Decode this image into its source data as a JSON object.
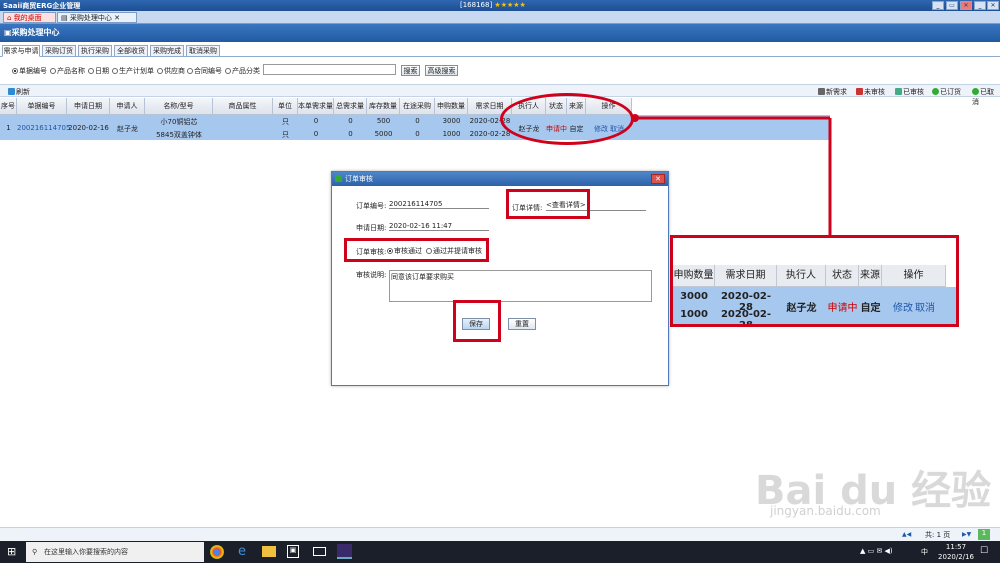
{
  "app": {
    "title": "Saaii商贸ERG企业管理",
    "license": "[168168]",
    "stars": "★★★★★"
  },
  "window_controls": [
    "_",
    "▭",
    "✕",
    "_",
    "▭",
    "✕"
  ],
  "top_tabs": [
    {
      "label": "我的桌面"
    },
    {
      "label": "采购处理中心"
    }
  ],
  "page_title": "采购处理中心",
  "sub_tabs": [
    "需求与申请",
    "采购订货",
    "执行采购",
    "全部收货",
    "采购完成",
    "取消采购"
  ],
  "search": {
    "options": [
      "单据编号",
      "产品名称",
      "日期",
      "生产计划单",
      "供应商",
      "合同编号",
      "产品分类"
    ],
    "selected": 0,
    "value": "",
    "search_label": "搜索",
    "advanced_label": "高级搜索"
  },
  "toolbar": {
    "refresh": "刷新",
    "actions": [
      "新需求",
      "未审核",
      "已审核",
      "已订货",
      "已取消"
    ]
  },
  "table": {
    "headers": [
      "序号",
      "单据编号",
      "申请日期",
      "申请人",
      "名称/型号",
      "商品属性",
      "单位",
      "本单需求量",
      "总需求量",
      "库存数量",
      "在途采购量",
      "申购数量",
      "需求日期",
      "执行人",
      "状态",
      "来源",
      "操作"
    ],
    "row": {
      "index": "1",
      "doc_no": "200216114705",
      "date": "2020-02-16",
      "applicant": "赵子龙",
      "items": [
        {
          "name": "小70铜铝芯",
          "unit": "只",
          "need": "0",
          "total": "0",
          "stock": "500",
          "transit": "0",
          "qty": "3000",
          "due": "2020-02-28"
        },
        {
          "name": "5845双盖钟体",
          "unit": "只",
          "need": "0",
          "total": "0",
          "stock": "5000",
          "transit": "0",
          "qty": "1000",
          "due": "2020-02-28"
        }
      ],
      "executor": "赵子龙",
      "status": "申请中",
      "source": "自定",
      "ops": [
        "修改",
        "取消"
      ]
    }
  },
  "zoom": {
    "headers": [
      "申购数量",
      "需求日期",
      "执行人",
      "状态",
      "来源",
      "操作"
    ],
    "qty": [
      "3000",
      "1000"
    ],
    "due": [
      "2020-02-28",
      "2020-02-28"
    ],
    "executor": "赵子龙",
    "status": "申请中",
    "source": "自定",
    "ops": [
      "修改",
      "取消"
    ]
  },
  "dialog": {
    "title": "订单审核",
    "close": "✕",
    "order_no_label": "订单编号:",
    "order_no": "200216114705",
    "detail_label": "订单详情:",
    "detail_link": "<查看详情>",
    "date_label": "申请日期:",
    "date": "2020-02-16 11:47",
    "review_label": "订单审核:",
    "review_options": [
      "审核通过",
      "通过并提请审核"
    ],
    "review_selected": 0,
    "note_label": "审核说明:",
    "note": "同意该订单要求购买",
    "save": "保存",
    "reset": "重置"
  },
  "pager": {
    "text": "共: 1 页",
    "page": "1"
  },
  "taskbar": {
    "search_placeholder": "在这里输入你要搜索的内容",
    "time": "11:57",
    "date": "2020/2/16"
  },
  "watermark": {
    "main": "Bai du 经验",
    "sub": "jingyan.baidu.com"
  },
  "colors": {
    "accent": "#2c62a8",
    "highlight_row": "#a6c8ee",
    "annotation": "#d0021b"
  }
}
